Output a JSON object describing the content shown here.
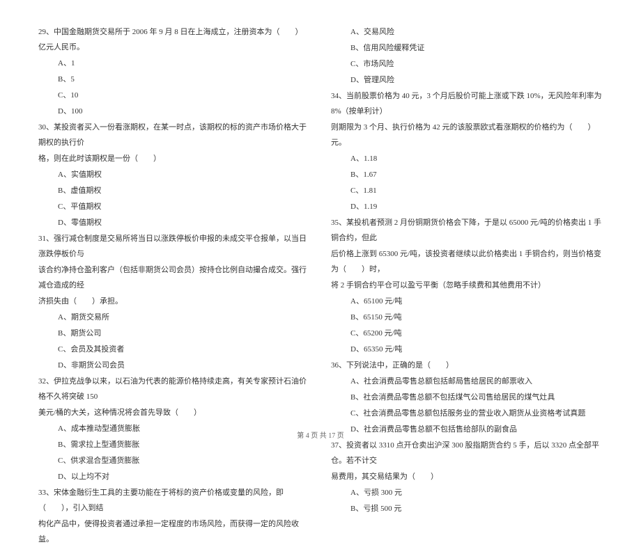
{
  "left": {
    "q29": {
      "text": "29、中国金融期货交易所于 2006 年 9 月 8 日在上海成立，注册资本为（　　）亿元人民币。",
      "a": "A、1",
      "b": "B、5",
      "c": "C、10",
      "d": "D、100"
    },
    "q30": {
      "text1": "30、某投资者买入一份看涨期权，在某一时点，该期权的标的资产市场价格大于期权的执行价",
      "text2": "格，则在此时该期权是一份（　　）",
      "a": "A、实值期权",
      "b": "B、虚值期权",
      "c": "C、平值期权",
      "d": "D、零值期权"
    },
    "q31": {
      "text1": "31、强行减仓制度是交易所将当日以涨跌停板价申报的未成交平仓报单，以当日涨跌停板价与",
      "text2": "该合约净持仓盈利客户（包括非期货公司会员）按持仓比例自动撮合成交。强行减仓造成的经",
      "text3": "济损失由（　　）承担。",
      "a": "A、期货交易所",
      "b": "B、期货公司",
      "c": "C、会员及其投资者",
      "d": "D、非期货公司会员"
    },
    "q32": {
      "text1": "32、伊拉克战争以来，以石油为代表的能源价格持续走高，有关专家预计石油价格不久将突破 150",
      "text2": "美元/桶的大关，这种情况将会首先导致（　　）",
      "a": "A、成本推动型通货膨胀",
      "b": "B、需求拉上型通货膨胀",
      "c": "C、供求混合型通货膨胀",
      "d": "D、以上均不对"
    },
    "q33": {
      "text1": "33、宋体金融衍生工具的主要功能在于将标的资产价格或变量的风险，即（　　），引入到结",
      "text2": "构化产品中，使得投资者通过承担一定程度的市场风险，而获得一定的风险收益。"
    }
  },
  "right": {
    "q33opts": {
      "a": "A、交易风险",
      "b": "B、信用风险缓释凭证",
      "c": "C、市场风险",
      "d": "D、管理风险"
    },
    "q34": {
      "text1": "34、当前股票价格为 40 元，3 个月后股价可能上涨或下跌 10%，无风险年利率为 8%（按单利计）",
      "text2": "则期限为 3 个月、执行价格为 42 元的该股票欧式看涨期权的价格约为（　　）元。",
      "a": "A、1.18",
      "b": "B、1.67",
      "c": "C、1.81",
      "d": "D、1.19"
    },
    "q35": {
      "text1": "35、某投机者预测 2 月份铜期货价格会下降，于是以 65000 元/吨的价格卖出 1 手铜合约，但此",
      "text2": "后价格上涨到 65300 元/吨，该投资者继续以此价格卖出 1 手铜合约，则当价格变为（　　）时，",
      "text3": "将 2 手铜合约平仓可以盈亏平衡（忽略手续费和其他费用不计）",
      "a": "A、65100 元/吨",
      "b": "B、65150 元/吨",
      "c": "C、65200 元/吨",
      "d": "D、65350 元/吨"
    },
    "q36": {
      "text": "36、下列说法中，正确的是（　　）",
      "a": "A、社会消费品零售总额包括邮局售给居民的邮票收入",
      "b": "B、社会消费品零售总额不包括煤气公司售给居民的煤气灶具",
      "c": "C、社会消费品零售总额包括服务业的营业收入期货从业资格考试真题",
      "d": "D、社会消费品零售总额不包括售给部队的副食品"
    },
    "q37": {
      "text1": "37、投资者以 3310 点开仓卖出沪深 300 股指期货合约 5 手，后以 3320 点全部平仓。若不计交",
      "text2": "易费用，其交易结果为（　　）",
      "a": "A、亏损 300 元",
      "b": "B、亏损 500 元"
    }
  },
  "footer": "第 4 页 共 17 页"
}
